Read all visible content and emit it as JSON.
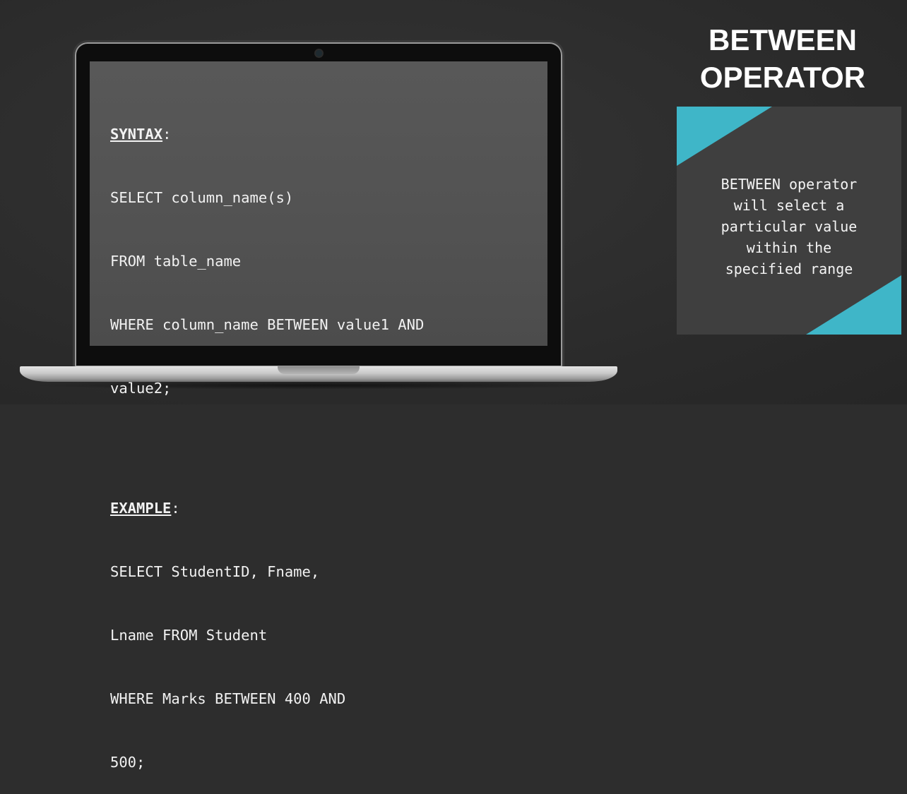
{
  "title": {
    "line1": "BETWEEN",
    "line2": "OPERATOR"
  },
  "syntax": {
    "label": "SYNTAX",
    "colon": ":",
    "lines": [
      "SELECT column_name(s)",
      "FROM table_name",
      "WHERE column_name BETWEEN value1 AND",
      "value2;"
    ]
  },
  "example": {
    "label": "EXAMPLE",
    "colon": ":",
    "lines": [
      "SELECT StudentID, Fname,",
      "Lname FROM Student",
      "WHERE Marks BETWEEN 400 AND",
      "500;"
    ]
  },
  "description": {
    "lines": [
      "BETWEEN operator",
      "will select a",
      "particular value",
      "within the",
      "specified range"
    ]
  },
  "colors": {
    "accent": "#3fb6c8",
    "background": "#2d2d2d",
    "panel": "#3f3f3f",
    "screen": "#555555"
  }
}
